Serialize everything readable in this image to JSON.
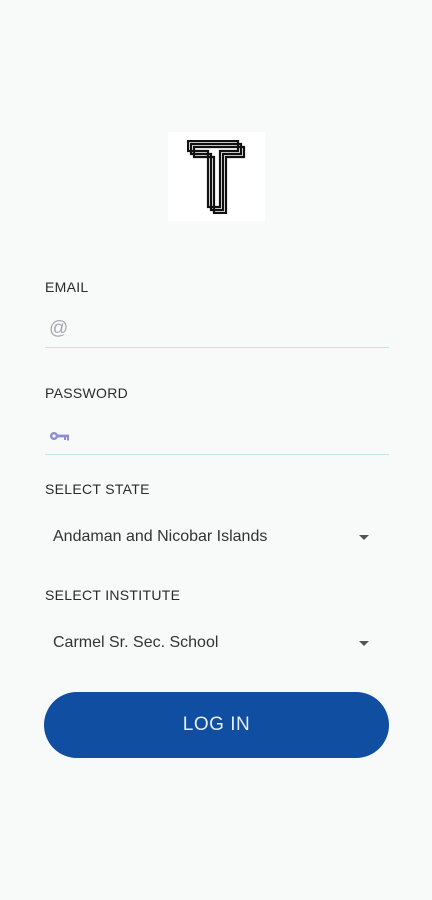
{
  "brand": {
    "logo_letter": "T"
  },
  "email": {
    "label": "EMAIL",
    "value": "",
    "placeholder": "",
    "icon": "at-icon"
  },
  "password": {
    "label": "PASSWORD",
    "value": "",
    "placeholder": "",
    "icon": "key-icon"
  },
  "state": {
    "label": "SELECT STATE",
    "selected": "Andaman and Nicobar Islands"
  },
  "institute": {
    "label": "SELECT INSTITUTE",
    "selected": "Carmel Sr. Sec. School"
  },
  "login": {
    "label": "LOG IN"
  },
  "colors": {
    "primary": "#0f4ea0",
    "underline": "#bfe3ea",
    "key_icon": "#8e8ed4",
    "background": "#f8f9f9"
  }
}
